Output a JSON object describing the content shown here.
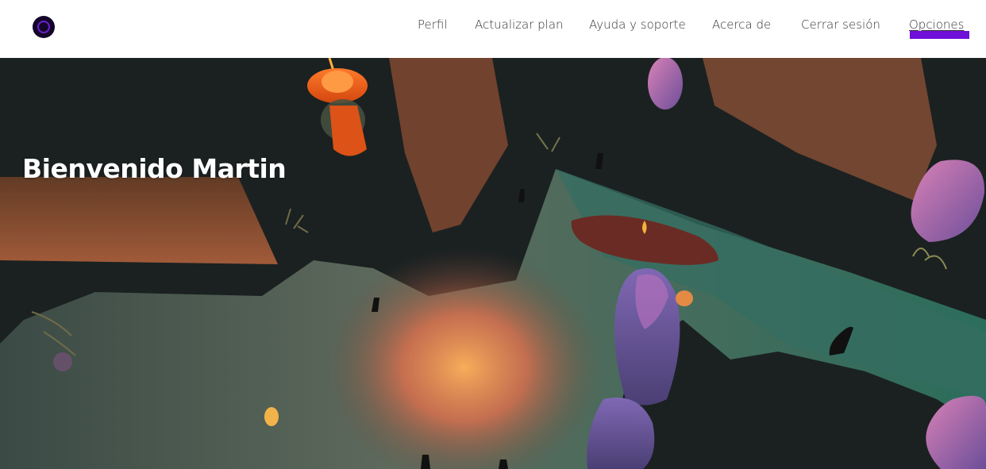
{
  "header": {
    "logo_icon": "circle-logo-icon",
    "nav": [
      {
        "label": "Perfil"
      },
      {
        "label": "Actualizar plan"
      },
      {
        "label": "Ayuda y soporte"
      },
      {
        "label": "Acerca de"
      },
      {
        "label": "Cerrar sesión"
      },
      {
        "label": "Opciones"
      }
    ],
    "active_nav_index": 5,
    "accent_color": "#6f10d8"
  },
  "hero": {
    "title": "Bienvenido Martin"
  }
}
